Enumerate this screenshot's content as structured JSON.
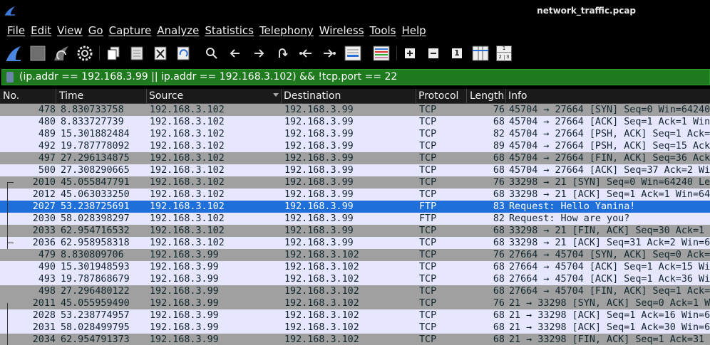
{
  "window": {
    "title": "network_traffic.pcap"
  },
  "menu": {
    "items": [
      "File",
      "Edit",
      "View",
      "Go",
      "Capture",
      "Analyze",
      "Statistics",
      "Telephony",
      "Wireless",
      "Tools",
      "Help"
    ]
  },
  "toolbar": {
    "buttons": [
      "start-capture-icon",
      "stop-capture-icon",
      "restart-capture-icon",
      "capture-options-icon",
      "open-file-icon",
      "save-file-icon",
      "close-file-icon",
      "reload-file-icon",
      "find-packet-icon",
      "go-back-icon",
      "go-forward-icon",
      "go-to-packet-icon",
      "go-first-icon",
      "go-last-icon",
      "autoscroll-icon",
      "colorize-icon",
      "zoom-in-icon",
      "zoom-out-icon",
      "normal-size-icon",
      "resize-columns-icon",
      "layout-icon"
    ],
    "zoom_normal_label": "1",
    "layout_labels": [
      "1",
      "2",
      "3"
    ]
  },
  "filter": {
    "value": "(ip.addr == 192.168.3.99 || ip.addr == 192.168.3.102) && !tcp.port == 22"
  },
  "columns": {
    "no": "No.",
    "time": "Time",
    "source": "Source",
    "destination": "Destination",
    "protocol": "Protocol",
    "length": "Length",
    "info": "Info"
  },
  "packets": [
    {
      "no": "478",
      "time": "8.830733758",
      "src": "192.168.3.102",
      "dst": "192.168.3.99",
      "proto": "TCP",
      "len": "76",
      "info": "45704 → 27664 [SYN] Seq=0 Win=64240",
      "style": "tcp-gray"
    },
    {
      "no": "480",
      "time": "8.833727739",
      "src": "192.168.3.102",
      "dst": "192.168.3.99",
      "proto": "TCP",
      "len": "68",
      "info": "45704 → 27664 [ACK] Seq=1 Ack=1 Win",
      "style": "tcp-light"
    },
    {
      "no": "489",
      "time": "15.301882484",
      "src": "192.168.3.102",
      "dst": "192.168.3.99",
      "proto": "TCP",
      "len": "82",
      "info": "45704 → 27664 [PSH, ACK] Seq=1 Ack=1",
      "style": "tcp-light"
    },
    {
      "no": "492",
      "time": "19.787778092",
      "src": "192.168.3.102",
      "dst": "192.168.3.99",
      "proto": "TCP",
      "len": "89",
      "info": "45704 → 27664 [PSH, ACK] Seq=15 Ack",
      "style": "tcp-light"
    },
    {
      "no": "497",
      "time": "27.296134875",
      "src": "192.168.3.102",
      "dst": "192.168.3.99",
      "proto": "TCP",
      "len": "68",
      "info": "45704 → 27664 [FIN, ACK] Seq=36 Ack",
      "style": "tcp-gray"
    },
    {
      "no": "500",
      "time": "27.308290665",
      "src": "192.168.3.102",
      "dst": "192.168.3.99",
      "proto": "TCP",
      "len": "68",
      "info": "45704 → 27664 [ACK] Seq=37 Ack=2 Wi",
      "style": "tcp-light"
    },
    {
      "no": "2010",
      "time": "45.055847791",
      "src": "192.168.3.102",
      "dst": "192.168.3.99",
      "proto": "TCP",
      "len": "76",
      "info": "33298 → 21 [SYN] Seq=0 Win=64240 Le",
      "style": "tcp-gray"
    },
    {
      "no": "2012",
      "time": "45.063033250",
      "src": "192.168.3.102",
      "dst": "192.168.3.99",
      "proto": "TCP",
      "len": "68",
      "info": "33298 → 21 [ACK] Seq=1 Ack=1 Win=64",
      "style": "tcp-light"
    },
    {
      "no": "2027",
      "time": "53.238725691",
      "src": "192.168.3.102",
      "dst": "192.168.3.99",
      "proto": "FTP",
      "len": "83",
      "info": "Request: Hello Yanina!",
      "style": "selected"
    },
    {
      "no": "2030",
      "time": "58.028398297",
      "src": "192.168.3.102",
      "dst": "192.168.3.99",
      "proto": "FTP",
      "len": "82",
      "info": "Request: How are you?",
      "style": "ftp"
    },
    {
      "no": "2033",
      "time": "62.954716532",
      "src": "192.168.3.102",
      "dst": "192.168.3.99",
      "proto": "TCP",
      "len": "68",
      "info": "33298 → 21 [FIN, ACK] Seq=30 Ack=1",
      "style": "tcp-gray"
    },
    {
      "no": "2036",
      "time": "62.958958318",
      "src": "192.168.3.102",
      "dst": "192.168.3.99",
      "proto": "TCP",
      "len": "68",
      "info": "33298 → 21 [ACK] Seq=31 Ack=2 Win=6",
      "style": "tcp-light"
    },
    {
      "no": "479",
      "time": "8.830809706",
      "src": "192.168.3.99",
      "dst": "192.168.3.102",
      "proto": "TCP",
      "len": "76",
      "info": "27664 → 45704 [SYN, ACK] Seq=0 Ack=1",
      "style": "tcp-gray"
    },
    {
      "no": "490",
      "time": "15.301948593",
      "src": "192.168.3.99",
      "dst": "192.168.3.102",
      "proto": "TCP",
      "len": "68",
      "info": "27664 → 45704 [ACK] Seq=1 Ack=15 Win",
      "style": "tcp-light"
    },
    {
      "no": "493",
      "time": "19.787868679",
      "src": "192.168.3.99",
      "dst": "192.168.3.102",
      "proto": "TCP",
      "len": "68",
      "info": "27664 → 45704 [ACK] Seq=1 Ack=36 Win",
      "style": "tcp-light"
    },
    {
      "no": "498",
      "time": "27.296480122",
      "src": "192.168.3.99",
      "dst": "192.168.3.102",
      "proto": "TCP",
      "len": "68",
      "info": "27664 → 45704 [FIN, ACK] Seq=1 Ack=37",
      "style": "tcp-gray"
    },
    {
      "no": "2011",
      "time": "45.055959490",
      "src": "192.168.3.99",
      "dst": "192.168.3.102",
      "proto": "TCP",
      "len": "76",
      "info": "21 → 33298 [SYN, ACK] Seq=0 Ack=1 Wi",
      "style": "tcp-gray"
    },
    {
      "no": "2028",
      "time": "53.238774957",
      "src": "192.168.3.99",
      "dst": "192.168.3.102",
      "proto": "TCP",
      "len": "68",
      "info": "21 → 33298 [ACK] Seq=1 Ack=16 Win=65",
      "style": "tcp-light"
    },
    {
      "no": "2031",
      "time": "58.028499795",
      "src": "192.168.3.99",
      "dst": "192.168.3.102",
      "proto": "TCP",
      "len": "68",
      "info": "21 → 33298 [ACK] Seq=1 Ack=30 Win=65",
      "style": "tcp-light"
    },
    {
      "no": "2034",
      "time": "62.954791373",
      "src": "192.168.3.99",
      "dst": "192.168.3.102",
      "proto": "TCP",
      "len": "68",
      "info": "21 → 33298 [FIN, ACK] Seq=1 Ack=31",
      "style": "tcp-gray"
    }
  ]
}
